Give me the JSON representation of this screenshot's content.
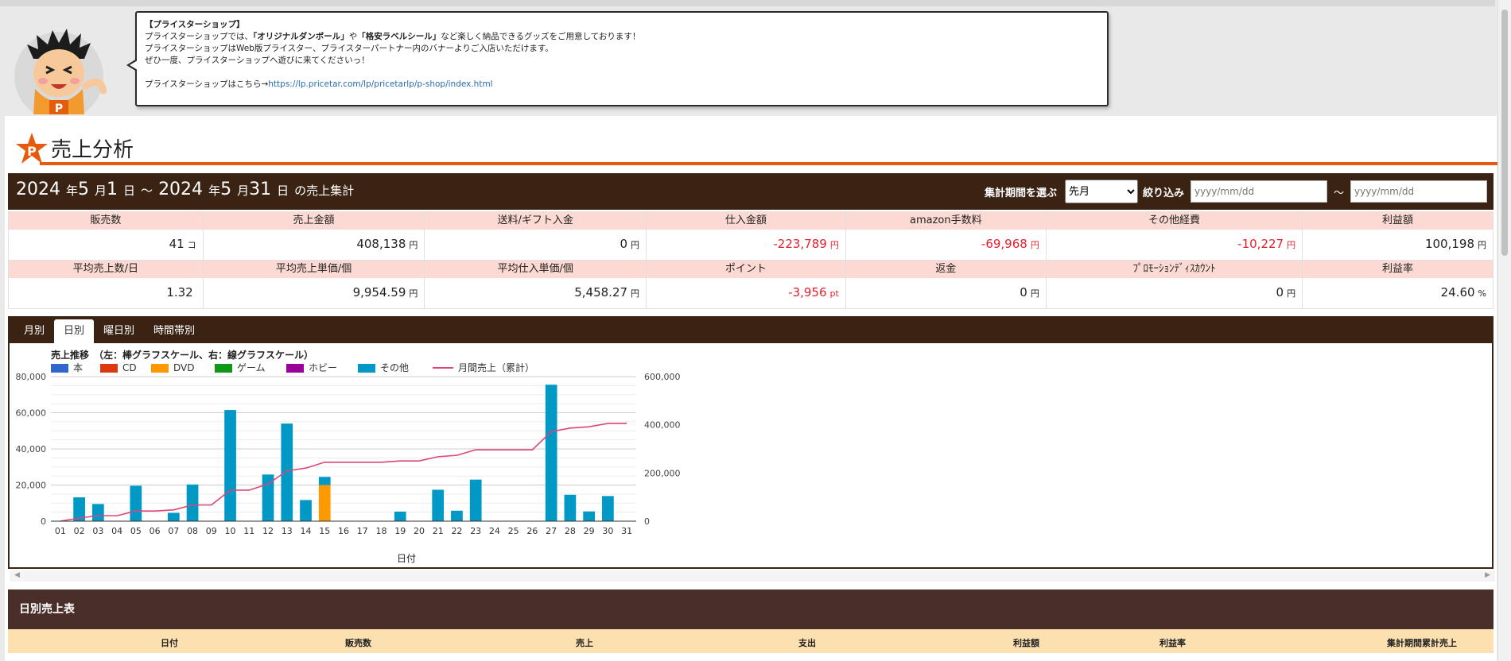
{
  "notice": {
    "heading": "【プライスターショップ】",
    "line1_pre": "プライスターショップでは、",
    "line1_b1": "「オリジナルダンボール」",
    "line1_mid": "や",
    "line1_b2": "「格安ラベルシール」",
    "line1_post": "など楽しく納品できるグッズをご用意しております！",
    "line2": "プライスターショップはWeb版プライスター、プライスターパートナー内のバナーよりご入店いただけます。",
    "line3": "ぜひ一度、プライスターショップへ遊びに来てくださいっ！",
    "link_prefix": "プライスターショップはこちら→",
    "link_url": "https://lp.pricetar.com/lp/pricetarlp/p-shop/index.html"
  },
  "page": {
    "title": "売上分析",
    "logo_letter": "P"
  },
  "summary": {
    "start_year": "2024",
    "start_month": "5",
    "start_day": "1",
    "end_year": "2024",
    "end_month": "5",
    "end_day": "31",
    "unit_year": "年",
    "unit_month": "月",
    "unit_day": "日",
    "sep": "～",
    "suffix": "の売上集計",
    "period_label": "集計期間を選ぶ",
    "period_value": "先月",
    "filter_label": "絞り込み",
    "date_placeholder": "yyyy/mm/dd",
    "tilde": "～"
  },
  "stats_row1": [
    {
      "label": "販売数",
      "value": "41",
      "unit": "コ",
      "neg": false
    },
    {
      "label": "売上金額",
      "value": "408,138",
      "unit": "円",
      "neg": false
    },
    {
      "label": "送料/ギフト入金",
      "value": "0",
      "unit": "円",
      "neg": false
    },
    {
      "label": "仕入金額",
      "value": "-223,789",
      "unit": "円",
      "neg": true
    },
    {
      "label": "amazon手数料",
      "value": "-69,968",
      "unit": "円",
      "neg": true
    },
    {
      "label": "その他経費",
      "value": "-10,227",
      "unit": "円",
      "neg": true
    },
    {
      "label": "利益額",
      "value": "100,198",
      "unit": "円",
      "neg": false
    }
  ],
  "stats_row2": [
    {
      "label": "平均売上数/日",
      "value": "1.32",
      "unit": "",
      "neg": false
    },
    {
      "label": "平均売上単価/個",
      "value": "9,954.59",
      "unit": "円",
      "neg": false
    },
    {
      "label": "平均仕入単価/個",
      "value": "5,458.27",
      "unit": "円",
      "neg": false
    },
    {
      "label": "ポイント",
      "value": "-3,956",
      "unit": "pt",
      "neg": true
    },
    {
      "label": "返金",
      "value": "0",
      "unit": "円",
      "neg": false
    },
    {
      "label": "ﾌﾟﾛﾓｰｼｮﾝﾃﾞｨｽｶｳﾝﾄ",
      "value": "0",
      "unit": "円",
      "neg": false
    },
    {
      "label": "利益率",
      "value": "24.60",
      "unit": "%",
      "neg": false
    }
  ],
  "tabs": [
    "月別",
    "日別",
    "曜日別",
    "時間帯別"
  ],
  "active_tab": 1,
  "chart_data": {
    "type": "bar",
    "title": "売上推移　（左：棒グラフスケール、右：線グラフスケール）",
    "xlabel": "日付",
    "categories": [
      "01",
      "02",
      "03",
      "04",
      "05",
      "06",
      "07",
      "08",
      "09",
      "10",
      "11",
      "12",
      "13",
      "14",
      "15",
      "16",
      "17",
      "18",
      "19",
      "20",
      "21",
      "22",
      "23",
      "24",
      "25",
      "26",
      "27",
      "28",
      "29",
      "30",
      "31"
    ],
    "ylim": [
      0,
      80000
    ],
    "y2lim": [
      0,
      600000
    ],
    "yticks": [
      "80,000",
      "60,000",
      "40,000",
      "20,000",
      "0"
    ],
    "y2ticks": [
      "600,000",
      "400,000",
      "200,000",
      "0"
    ],
    "stacked": true,
    "series": [
      {
        "name": "本",
        "color": "#3366cc",
        "values": [
          0,
          0,
          0,
          0,
          0,
          0,
          0,
          0,
          0,
          0,
          0,
          0,
          0,
          0,
          0,
          0,
          0,
          0,
          0,
          0,
          0,
          0,
          0,
          0,
          0,
          0,
          0,
          0,
          0,
          0,
          0
        ]
      },
      {
        "name": "CD",
        "color": "#dc3912",
        "values": [
          0,
          0,
          0,
          0,
          0,
          0,
          0,
          0,
          0,
          0,
          0,
          0,
          0,
          0,
          0,
          0,
          0,
          0,
          0,
          0,
          0,
          0,
          0,
          0,
          0,
          0,
          0,
          0,
          0,
          0,
          0
        ]
      },
      {
        "name": "DVD",
        "color": "#ff9900",
        "values": [
          0,
          0,
          0,
          0,
          0,
          0,
          0,
          0,
          0,
          0,
          0,
          0,
          0,
          0,
          20000,
          0,
          0,
          0,
          0,
          0,
          0,
          0,
          0,
          0,
          0,
          0,
          0,
          0,
          0,
          0,
          0
        ]
      },
      {
        "name": "ゲーム",
        "color": "#109618",
        "values": [
          0,
          0,
          0,
          0,
          0,
          0,
          0,
          0,
          0,
          0,
          0,
          0,
          0,
          0,
          0,
          0,
          0,
          0,
          0,
          0,
          0,
          0,
          0,
          0,
          0,
          0,
          0,
          0,
          0,
          0,
          0
        ]
      },
      {
        "name": "ホビー",
        "color": "#990099",
        "values": [
          0,
          0,
          0,
          0,
          0,
          0,
          0,
          0,
          0,
          0,
          0,
          0,
          0,
          0,
          0,
          0,
          0,
          0,
          0,
          0,
          0,
          0,
          0,
          0,
          0,
          0,
          0,
          0,
          0,
          0,
          0
        ]
      },
      {
        "name": "その他",
        "color": "#0099c6",
        "values": [
          0,
          13200,
          9500,
          0,
          19600,
          0,
          4600,
          20300,
          0,
          61500,
          0,
          25800,
          54000,
          11700,
          4500,
          0,
          0,
          0,
          5300,
          0,
          17400,
          5800,
          23000,
          0,
          0,
          0,
          75500,
          14600,
          5400,
          13900,
          0
        ]
      }
    ],
    "line": {
      "name": "月間売上（累計）",
      "color": "#dd4477",
      "values": [
        0,
        13200,
        22700,
        22700,
        42300,
        42300,
        46900,
        67200,
        67200,
        128700,
        128700,
        154500,
        208500,
        220200,
        244700,
        244700,
        244700,
        244700,
        250000,
        250000,
        267400,
        273200,
        296200,
        296200,
        296200,
        296200,
        371700,
        386300,
        391700,
        405600,
        405600
      ]
    }
  },
  "daily_table": {
    "title": "日別売上表",
    "headers": [
      "日付",
      "販売数",
      "売上",
      "支出",
      "利益額",
      "利益率",
      "集計期間累計売上"
    ]
  }
}
